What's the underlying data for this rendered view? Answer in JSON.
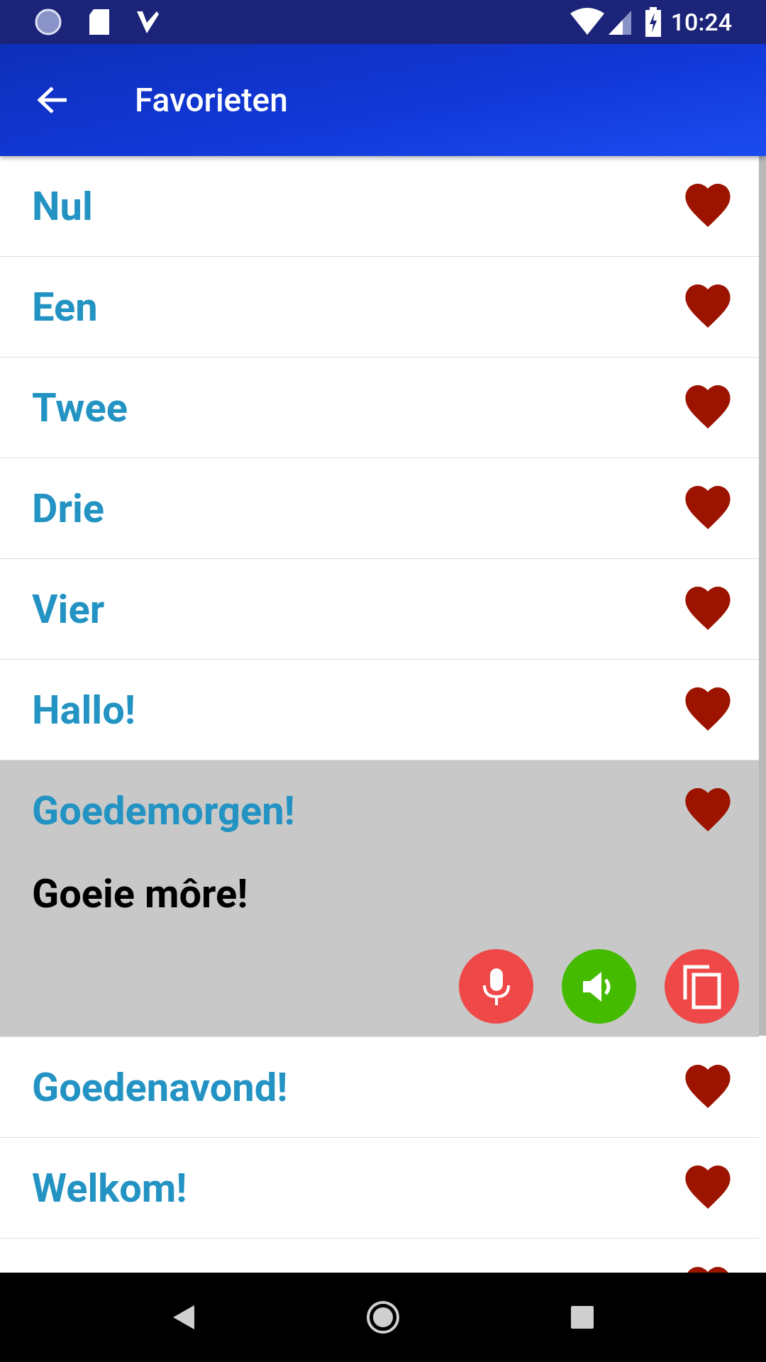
{
  "status_bar": {
    "time": "10:24"
  },
  "app_bar": {
    "title": "Favorieten"
  },
  "items": [
    {
      "phrase": "Nul",
      "favorite": true,
      "expanded": false
    },
    {
      "phrase": "Een",
      "favorite": true,
      "expanded": false
    },
    {
      "phrase": "Twee",
      "favorite": true,
      "expanded": false
    },
    {
      "phrase": "Drie",
      "favorite": true,
      "expanded": false
    },
    {
      "phrase": "Vier",
      "favorite": true,
      "expanded": false
    },
    {
      "phrase": "Hallo!",
      "favorite": true,
      "expanded": false
    },
    {
      "phrase": "Goedemorgen!",
      "favorite": true,
      "expanded": true,
      "translation": "Goeie môre!"
    },
    {
      "phrase": "Goedenavond!",
      "favorite": true,
      "expanded": false
    },
    {
      "phrase": "Welkom!",
      "favorite": true,
      "expanded": false
    }
  ],
  "partial_item": {
    "favorite": true
  }
}
